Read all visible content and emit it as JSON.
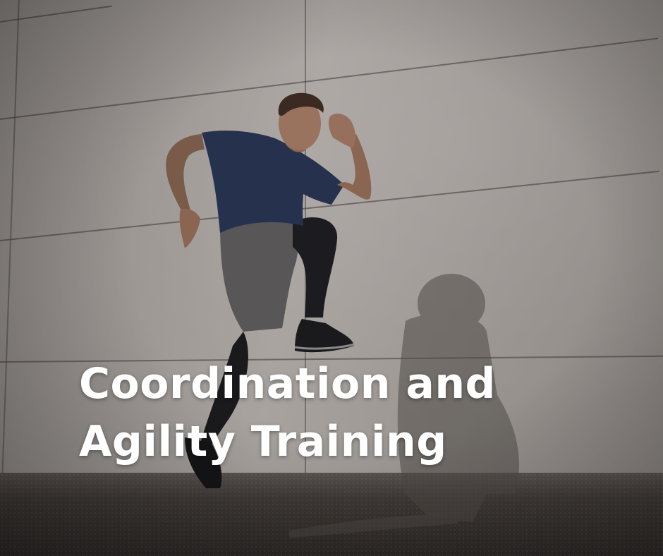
{
  "headline": {
    "line1": "Coordination and",
    "line2": "Agility Training"
  },
  "colors": {
    "text": "#ffffff",
    "wall": "#a8a39f",
    "ground": "#3a3633",
    "shirt": "#26324d"
  }
}
